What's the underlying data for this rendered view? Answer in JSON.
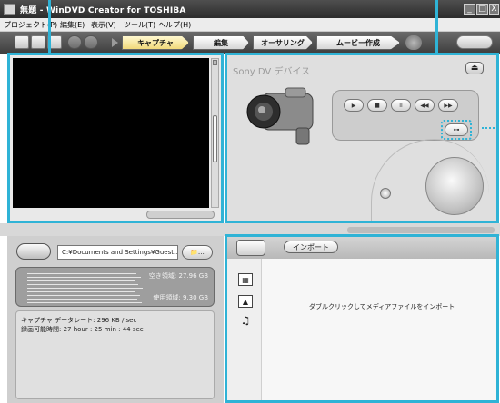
{
  "window": {
    "title": "無題 - WinDVD Creator for TOSHIBA",
    "minimize": "_",
    "maximize": "□",
    "close": "X"
  },
  "menu": [
    "プロジェクト(P)",
    "編集(E)",
    "表示(V)",
    "ツール(T)",
    "ヘルプ(H)"
  ],
  "tabs": {
    "capture": "キャプチャ",
    "edit": "編集",
    "authoring": "オーサリング",
    "movie": "ムービー作成"
  },
  "device": {
    "name": "Sony DV デバイス",
    "eject": "⏏"
  },
  "controls": {
    "play": "▶",
    "stop": "■",
    "pause": "II",
    "rewind": "◀◀",
    "forward": "▶▶",
    "settings": "⊶"
  },
  "capture": {
    "path": "C:¥Documents and Settings¥Guest...",
    "browse": "📁…",
    "free_space": "空き領域: 27.96 GB",
    "used_space": "使用領域: 9.30 GB",
    "data_rate": "キャプチャ データレート: 296 KB / sec",
    "record_time": "録画可能時間: 27 hour : 25 min : 44 sec"
  },
  "media": {
    "import": "インポート",
    "hint": "ダブルクリックしてメディアファイルをインポート",
    "icons": [
      "film-icon",
      "image-icon",
      "music-icon"
    ]
  },
  "colors": {
    "accent": "#2fb3d6"
  }
}
